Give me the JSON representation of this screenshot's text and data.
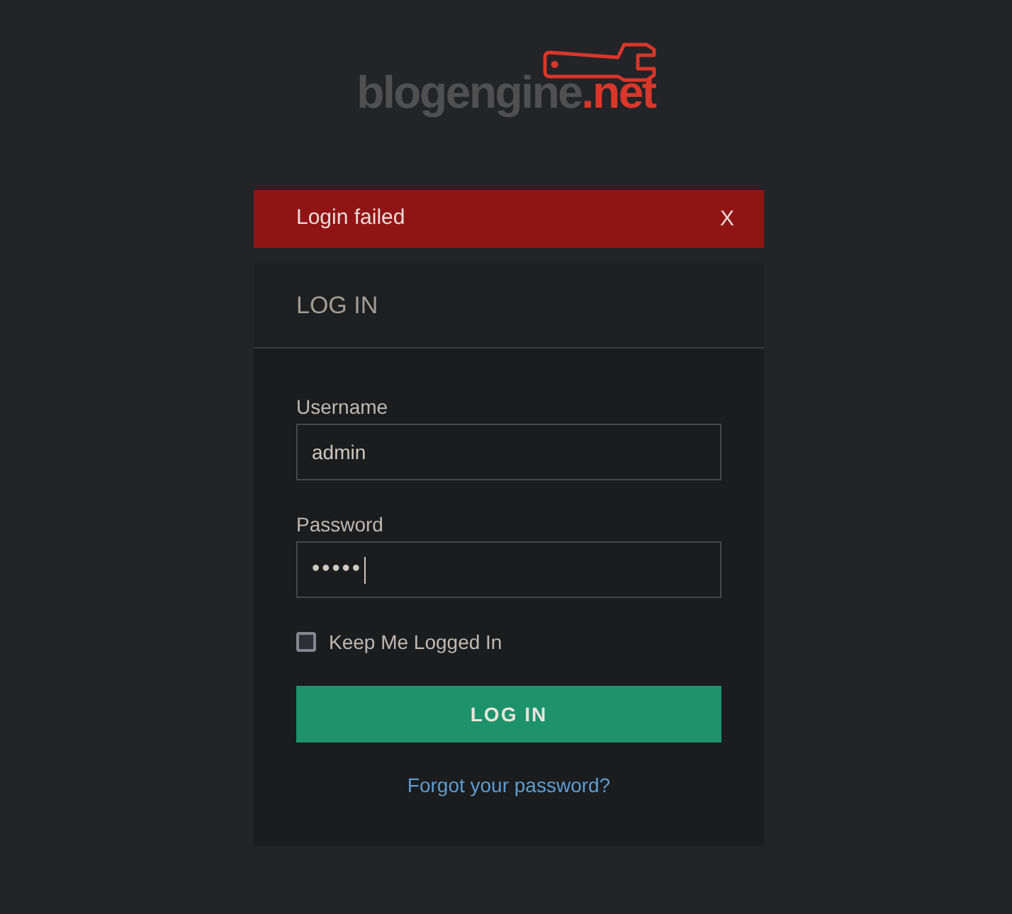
{
  "logo": {
    "name": "blogengine",
    "suffix": ".net"
  },
  "alert": {
    "message": "Login failed",
    "close": "X"
  },
  "login": {
    "title": "LOG IN",
    "fields": [
      {
        "kind": "text",
        "label": "Username",
        "value": "admin",
        "focused": false
      },
      {
        "kind": "password",
        "label": "Password",
        "value": "•••••",
        "focused": true
      }
    ],
    "remember": {
      "label": "Keep Me Logged In",
      "checked": false
    },
    "submit": "LOG IN",
    "forgot_link": "Forgot your password?"
  }
}
